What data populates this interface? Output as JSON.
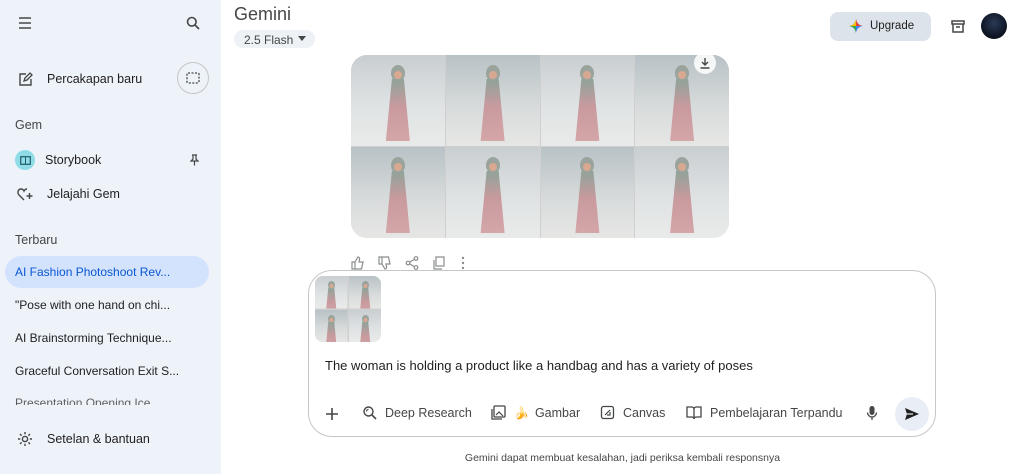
{
  "sidebar": {
    "new_chat": "Percakapan baru",
    "gem_heading": "Gem",
    "gems": [
      "Storybook",
      "Jelajahi Gem"
    ],
    "recent_heading": "Terbaru",
    "recent_items": [
      "AI Fashion Photoshoot Rev...",
      "\"Pose with one hand on chi...",
      "AI Brainstorming Technique...",
      "Graceful Conversation Exit S...",
      "Presentation Opening Ice..."
    ],
    "settings": "Setelan & bantuan"
  },
  "header": {
    "app_title": "Gemini",
    "model": "2.5 Flash",
    "upgrade": "Upgrade"
  },
  "composer": {
    "prompt_text": "The woman is holding a product like a handbag and has a variety of poses",
    "tools": {
      "deep_research": "Deep Research",
      "image": "Gambar",
      "image_emoji": "🍌",
      "canvas": "Canvas",
      "guided_learning": "Pembelajaran Terpandu"
    }
  },
  "footer": {
    "disclaimer": "Gemini dapat membuat kesalahan, jadi periksa kembali responsnya"
  },
  "colors": {
    "sidebar_bg": "#eef2f9",
    "active_item_bg": "#d3e3fd",
    "active_item_text": "#0b57d0",
    "upgrade_bg": "#dde3ea"
  }
}
